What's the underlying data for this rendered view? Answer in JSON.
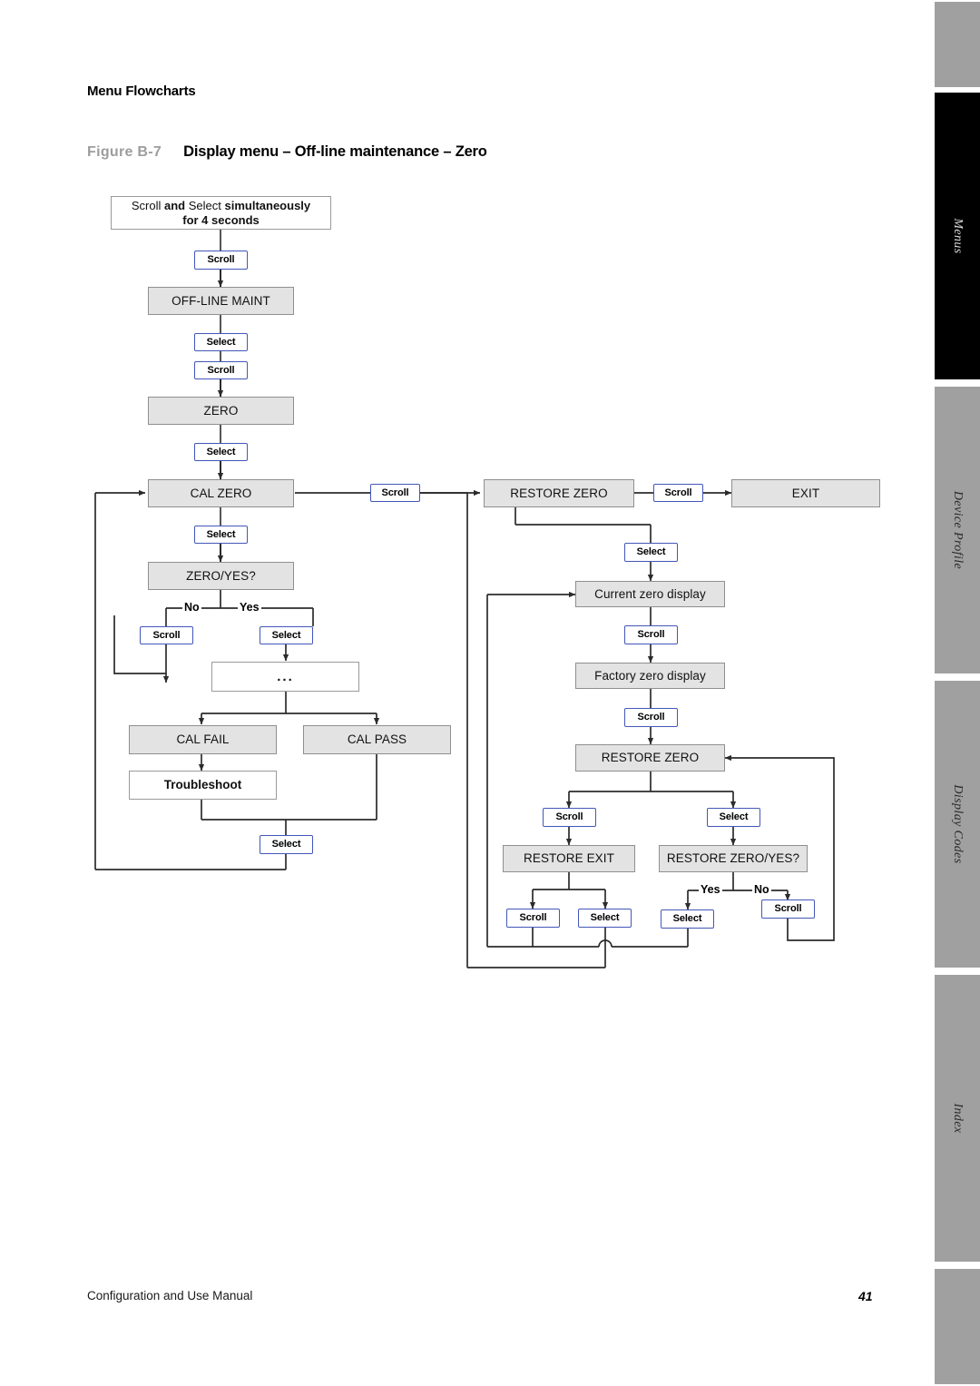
{
  "header": {
    "section_title": "Menu Flowcharts",
    "figure_label": "Figure B-7",
    "figure_caption": "Display menu – Off-line maintenance – Zero"
  },
  "footer": {
    "manual_title": "Configuration and Use Manual",
    "page_number": "41"
  },
  "side_tabs": [
    {
      "label": "Menus",
      "active": true
    },
    {
      "label": "Device Profile",
      "active": false
    },
    {
      "label": "Display Codes",
      "active": false
    },
    {
      "label": "Index",
      "active": false
    }
  ],
  "colors": {
    "state_fill": "#e3e3e3",
    "state_border": "#8f8f8f",
    "action_border": "#4257b8",
    "line": "#2b2b2b",
    "figure_label": "#9d9d9d",
    "tab_inactive": "#a0a0a0",
    "tab_active": "#000000"
  },
  "flowchart": {
    "type": "flowchart",
    "title": "Display menu – Off-line maintenance – Zero",
    "start": {
      "line1_a": "Scroll",
      "line1_b": "and",
      "line1_c": "Select",
      "line1_d": "simultaneously",
      "line2": "for 4 seconds"
    },
    "nodes": {
      "off_line_maint": "OFF-LINE MAINT",
      "zero": "ZERO",
      "cal_zero": "CAL ZERO",
      "zero_yes": "ZERO/YES?",
      "ellipsis": "...",
      "cal_fail": "CAL FAIL",
      "cal_pass": "CAL PASS",
      "troubleshoot": "Troubleshoot",
      "restore_zero_top": "RESTORE ZERO",
      "exit": "EXIT",
      "current_zero_display": "Current zero display",
      "factory_zero_display": "Factory zero display",
      "restore_zero_mid": "RESTORE ZERO",
      "restore_exit": "RESTORE EXIT",
      "restore_zero_yes": "RESTORE ZERO/YES?"
    },
    "actions": {
      "a_scroll_1": "Scroll",
      "a_select_1": "Select",
      "a_scroll_2": "Scroll",
      "a_select_2": "Select",
      "a_select_3": "Select",
      "a_scroll_no": "Scroll",
      "a_select_yes": "Select",
      "a_select_calresult": "Select",
      "a_scroll_to_restore": "Scroll",
      "a_scroll_to_exit": "Scroll",
      "a_select_restore": "Select",
      "a_scroll_current": "Scroll",
      "a_scroll_factory": "Scroll",
      "a_scroll_restore_exit": "Scroll",
      "a_select_restore_yes": "Select",
      "a_scroll_rexit": "Scroll",
      "a_select_rexit": "Select",
      "a_select_rzy_yes": "Select",
      "a_scroll_rzy_no": "Scroll"
    },
    "branch_labels": {
      "zero_no": "No",
      "zero_yes": "Yes",
      "restore_yes": "Yes",
      "restore_no": "No"
    }
  }
}
